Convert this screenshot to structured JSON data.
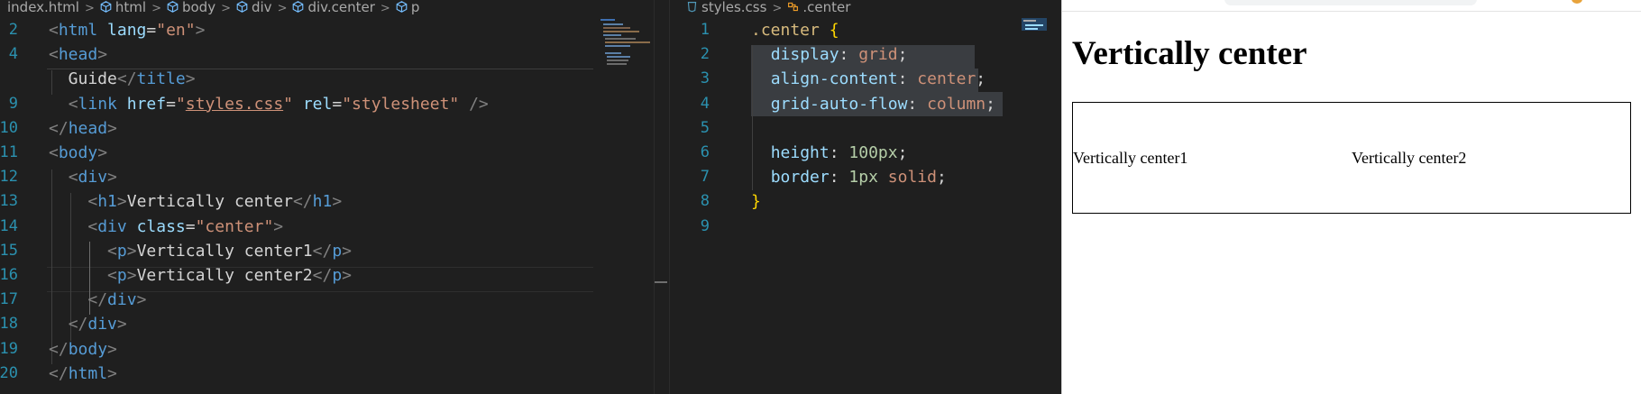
{
  "html_editor": {
    "breadcrumbs": [
      "index.html",
      "html",
      "body",
      "div",
      "div.center",
      "p"
    ],
    "lines": [
      {
        "num": "2",
        "tokens": [
          [
            "tg",
            "<"
          ],
          [
            "tn",
            "html"
          ],
          [
            "tx",
            " "
          ],
          [
            "an",
            "lang"
          ],
          [
            "tx",
            "="
          ],
          [
            "av",
            "\"en\""
          ],
          [
            "tg",
            ">"
          ]
        ]
      },
      {
        "num": "4",
        "tokens": [
          [
            "tg",
            "<"
          ],
          [
            "tn",
            "head"
          ],
          [
            "tg",
            ">"
          ]
        ]
      },
      {
        "num": "",
        "tokens": [
          [
            "tx",
            "  Guide"
          ],
          [
            "tg",
            "</"
          ],
          [
            "tn",
            "title"
          ],
          [
            "tg",
            ">"
          ]
        ]
      },
      {
        "num": "9",
        "tokens": [
          [
            "tx",
            "  "
          ],
          [
            "tg",
            "<"
          ],
          [
            "tn",
            "link"
          ],
          [
            "tx",
            " "
          ],
          [
            "an",
            "href"
          ],
          [
            "tx",
            "="
          ],
          [
            "av",
            "\""
          ],
          [
            "av",
            "styles.css"
          ],
          [
            "av",
            "\""
          ],
          [
            "tx",
            " "
          ],
          [
            "an",
            "rel"
          ],
          [
            "tx",
            "="
          ],
          [
            "av",
            "\"stylesheet\""
          ],
          [
            "tx",
            " "
          ],
          [
            "tg",
            "/>"
          ]
        ]
      },
      {
        "num": "10",
        "tokens": [
          [
            "tg",
            "</"
          ],
          [
            "tn",
            "head"
          ],
          [
            "tg",
            ">"
          ]
        ]
      },
      {
        "num": "11",
        "tokens": [
          [
            "tg",
            "<"
          ],
          [
            "tn",
            "body"
          ],
          [
            "tg",
            ">"
          ]
        ]
      },
      {
        "num": "12",
        "tokens": [
          [
            "tx",
            "  "
          ],
          [
            "tg",
            "<"
          ],
          [
            "tn",
            "div"
          ],
          [
            "tg",
            ">"
          ]
        ]
      },
      {
        "num": "13",
        "tokens": [
          [
            "tx",
            "    "
          ],
          [
            "tg",
            "<"
          ],
          [
            "tn",
            "h1"
          ],
          [
            "tg",
            ">"
          ],
          [
            "tx",
            "Vertically center"
          ],
          [
            "tg",
            "</"
          ],
          [
            "tn",
            "h1"
          ],
          [
            "tg",
            ">"
          ]
        ]
      },
      {
        "num": "14",
        "tokens": [
          [
            "tx",
            "    "
          ],
          [
            "tg",
            "<"
          ],
          [
            "tn",
            "div"
          ],
          [
            "tx",
            " "
          ],
          [
            "an",
            "class"
          ],
          [
            "tx",
            "="
          ],
          [
            "av",
            "\"center\""
          ],
          [
            "tg",
            ">"
          ]
        ]
      },
      {
        "num": "15",
        "tokens": [
          [
            "tx",
            "      "
          ],
          [
            "tg",
            "<"
          ],
          [
            "tn",
            "p"
          ],
          [
            "tg",
            ">"
          ],
          [
            "tx",
            "Vertically center1"
          ],
          [
            "tg",
            "</"
          ],
          [
            "tn",
            "p"
          ],
          [
            "tg",
            ">"
          ]
        ]
      },
      {
        "num": "16",
        "tokens": [
          [
            "tx",
            "      "
          ],
          [
            "tg",
            "<"
          ],
          [
            "tn",
            "p"
          ],
          [
            "tg",
            ">"
          ],
          [
            "tx",
            "Vertically center2"
          ],
          [
            "tg",
            "</"
          ],
          [
            "tn",
            "p"
          ],
          [
            "tg",
            ">"
          ]
        ]
      },
      {
        "num": "17",
        "tokens": [
          [
            "tx",
            "    "
          ],
          [
            "tg",
            "</"
          ],
          [
            "tn",
            "div"
          ],
          [
            "tg",
            ">"
          ]
        ]
      },
      {
        "num": "18",
        "tokens": [
          [
            "tx",
            "  "
          ],
          [
            "tg",
            "</"
          ],
          [
            "tn",
            "div"
          ],
          [
            "tg",
            ">"
          ]
        ]
      },
      {
        "num": "19",
        "tokens": [
          [
            "tg",
            "</"
          ],
          [
            "tn",
            "body"
          ],
          [
            "tg",
            ">"
          ]
        ]
      },
      {
        "num": "20",
        "tokens": [
          [
            "tg",
            "</"
          ],
          [
            "tn",
            "html"
          ],
          [
            "tg",
            ">"
          ]
        ]
      }
    ]
  },
  "css_editor": {
    "breadcrumbs": [
      "styles.css",
      ".center"
    ],
    "lines": [
      {
        "num": "1",
        "tokens": [
          [
            "sel",
            ".center"
          ],
          [
            "tx",
            " "
          ],
          [
            "br",
            "{"
          ]
        ]
      },
      {
        "num": "2",
        "tokens": [
          [
            "tx",
            "  "
          ],
          [
            "pn",
            "display"
          ],
          [
            "pu",
            ": "
          ],
          [
            "pv",
            "grid"
          ],
          [
            "pu",
            ";"
          ]
        ]
      },
      {
        "num": "3",
        "tokens": [
          [
            "tx",
            "  "
          ],
          [
            "pn",
            "align-content"
          ],
          [
            "pu",
            ": "
          ],
          [
            "pv",
            "center"
          ],
          [
            "pu",
            ";"
          ]
        ]
      },
      {
        "num": "4",
        "tokens": [
          [
            "tx",
            "  "
          ],
          [
            "pn",
            "grid-auto-flow"
          ],
          [
            "pu",
            ": "
          ],
          [
            "pv",
            "column"
          ],
          [
            "pu",
            ";"
          ]
        ]
      },
      {
        "num": "5",
        "tokens": []
      },
      {
        "num": "6",
        "tokens": [
          [
            "tx",
            "  "
          ],
          [
            "pn",
            "height"
          ],
          [
            "pu",
            ": "
          ],
          [
            "nm",
            "100px"
          ],
          [
            "pu",
            ";"
          ]
        ]
      },
      {
        "num": "7",
        "tokens": [
          [
            "tx",
            "  "
          ],
          [
            "pn",
            "border"
          ],
          [
            "pu",
            ": "
          ],
          [
            "nm",
            "1px"
          ],
          [
            "pu",
            " "
          ],
          [
            "pv",
            "solid"
          ],
          [
            "pu",
            ";"
          ]
        ]
      },
      {
        "num": "8",
        "tokens": [
          [
            "br",
            "}"
          ]
        ]
      },
      {
        "num": "9",
        "tokens": []
      }
    ]
  },
  "browser": {
    "heading": "Vertically center",
    "paragraphs": [
      "Vertically center1",
      "Vertically center2"
    ]
  },
  "colors": {
    "editor_bg": "#1f1f1f",
    "line_number": "#2b91af",
    "tag": "#569cd6",
    "attr_name": "#9cdcfe",
    "string": "#ce9178",
    "number": "#b5cea8",
    "selector": "#d7ba7d",
    "bracket": "#ffd700",
    "selection": "#3a3d41"
  }
}
